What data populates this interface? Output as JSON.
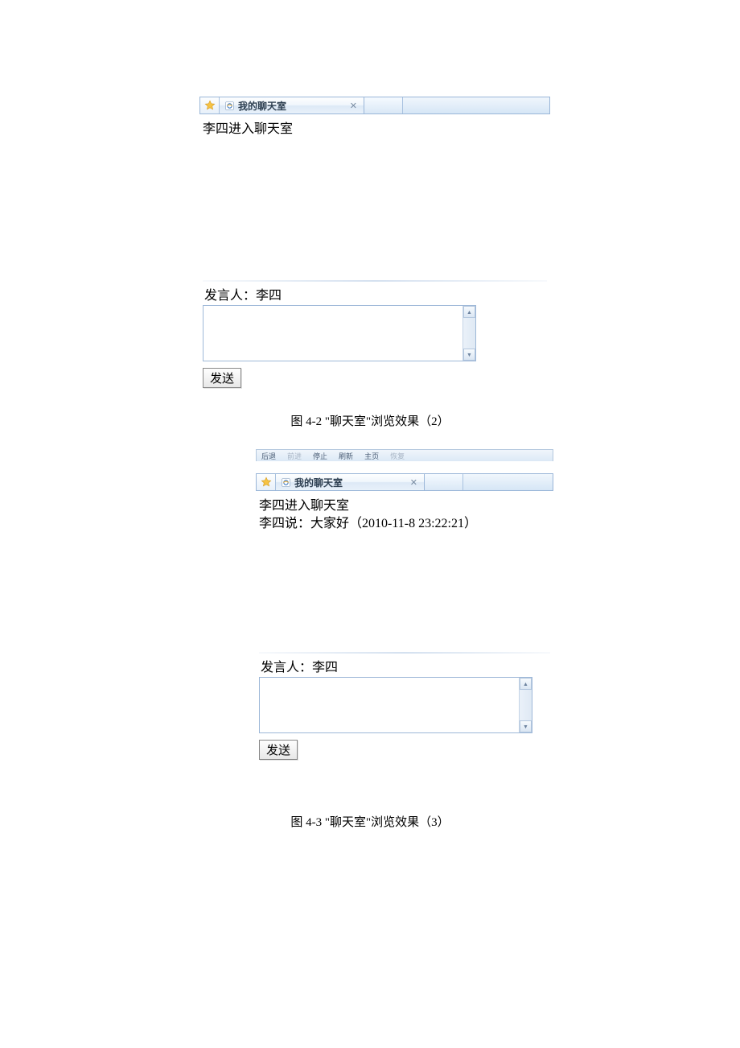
{
  "figure1": {
    "tab_title": "我的聊天室",
    "chat_lines": [
      "李四进入聊天室"
    ],
    "speaker_label": "发言人：李四",
    "send_button": "发送",
    "caption": "图 4-2  \"聊天室\"浏览效果（2）"
  },
  "figure2": {
    "toolbar": {
      "back": "后退",
      "forward": "前进",
      "stop": "停止",
      "refresh": "刷新",
      "home": "主页",
      "restore": "恢复"
    },
    "tab_title": "我的聊天室",
    "chat_lines": [
      "李四进入聊天室",
      "李四说：大家好（2010-11-8 23:22:21）"
    ],
    "speaker_label": "发言人：李四",
    "send_button": "发送",
    "caption": "图 4-3  \"聊天室\"浏览效果（3）"
  }
}
